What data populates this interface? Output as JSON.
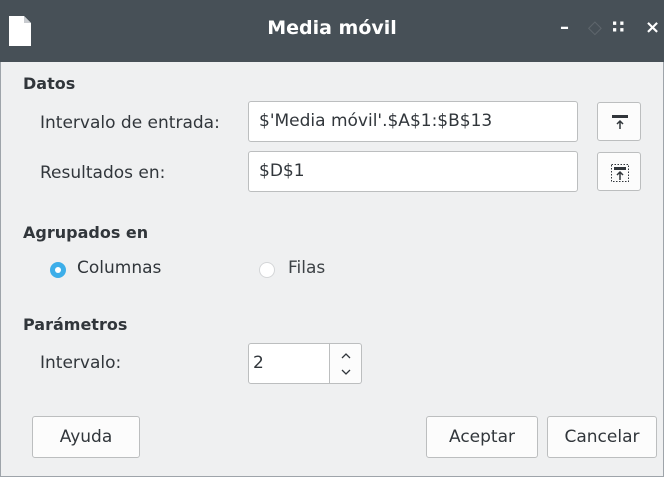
{
  "window": {
    "title": "Media móvil",
    "minimize_glyph": "–",
    "maximize_glyph": "◇",
    "grip_glyph": "∷",
    "close_glyph": "×"
  },
  "datos": {
    "heading": "Datos",
    "input_range_label": "Intervalo de entrada:",
    "input_range_value": "$'Media móvil'.$A$1:$B$13",
    "results_label": "Resultados en:",
    "results_value": "$D$1"
  },
  "agrupados": {
    "heading": "Agrupados en",
    "options": [
      {
        "label": "Columnas",
        "selected": true
      },
      {
        "label": "Filas",
        "selected": false
      }
    ]
  },
  "parametros": {
    "heading": "Parámetros",
    "interval_label": "Intervalo:",
    "interval_value": "2"
  },
  "buttons": {
    "help": "Ayuda",
    "ok": "Aceptar",
    "cancel": "Cancelar"
  },
  "colors": {
    "titlebar": "#475057",
    "dialog_bg": "#eff0f1",
    "accent": "#3daee9"
  },
  "icons": {
    "app": "document-icon",
    "range_shrink": "shrink-icon"
  }
}
